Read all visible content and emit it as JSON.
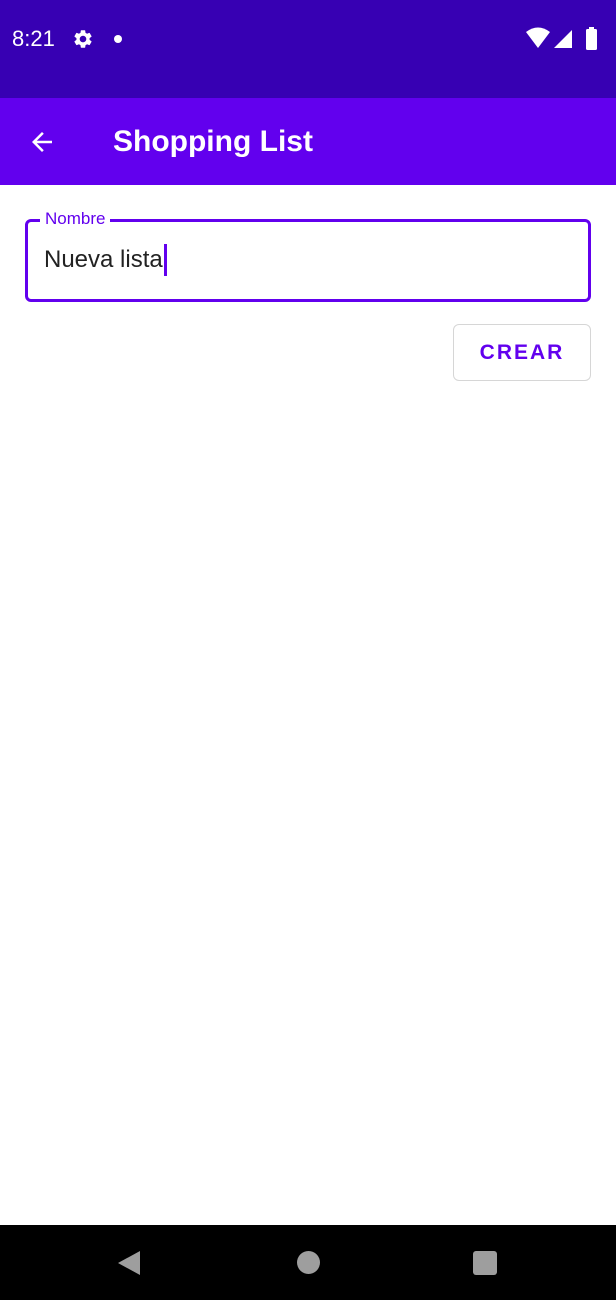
{
  "status_bar": {
    "time": "8:21",
    "icons": [
      "settings-icon",
      "notification-dot-icon",
      "wifi-icon",
      "signal-icon",
      "battery-icon"
    ]
  },
  "app_bar": {
    "title": "Shopping List",
    "back_icon": "arrow-back-icon"
  },
  "form": {
    "name_field": {
      "label": "Nombre",
      "value": "Nueva lista"
    },
    "create_button_label": "CREAR"
  },
  "nav_bar": {
    "icons": [
      "nav-back-icon",
      "nav-home-icon",
      "nav-recents-icon"
    ]
  },
  "colors": {
    "status_bar": "#3700b3",
    "app_bar": "#6200ee",
    "accent": "#6200ee",
    "background": "#ffffff",
    "nav_bar": "#000000"
  }
}
